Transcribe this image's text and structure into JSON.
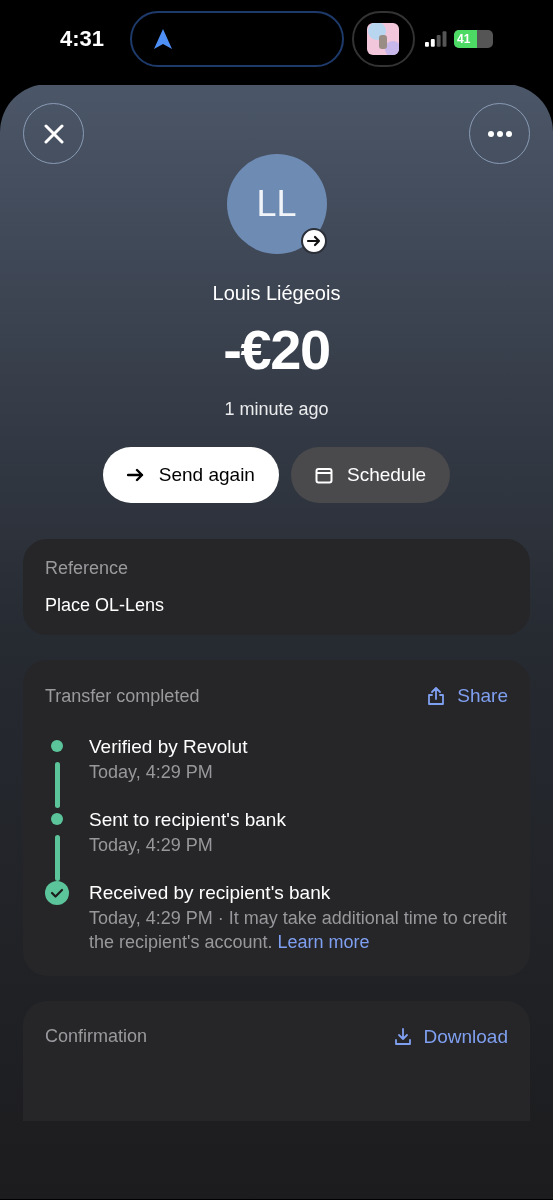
{
  "status_bar": {
    "time": "4:31",
    "battery": "41"
  },
  "header": {
    "avatar_initials": "LL",
    "name": "Louis Liégeois",
    "amount": "-€20",
    "time_ago": "1 minute ago"
  },
  "actions": [
    {
      "label": "Send again",
      "kind": "primary"
    },
    {
      "label": "Schedule",
      "kind": "secondary"
    }
  ],
  "reference": {
    "title": "Reference",
    "value": "Place OL-Lens"
  },
  "transfer": {
    "title": "Transfer completed",
    "share": "Share",
    "steps": [
      {
        "kind": "dot",
        "title": "Verified by Revolut",
        "detail": "Today, 4:29 PM"
      },
      {
        "kind": "dot",
        "title": "Sent to recipient's bank",
        "detail": "Today, 4:29 PM"
      },
      {
        "kind": "check",
        "title": "Received by recipient's bank",
        "detail": "Today, 4:29 PM · It may take additional time to credit the recipient's account.",
        "link": "Learn more"
      }
    ]
  },
  "confirmation": {
    "title": "Confirmation",
    "download": "Download"
  }
}
